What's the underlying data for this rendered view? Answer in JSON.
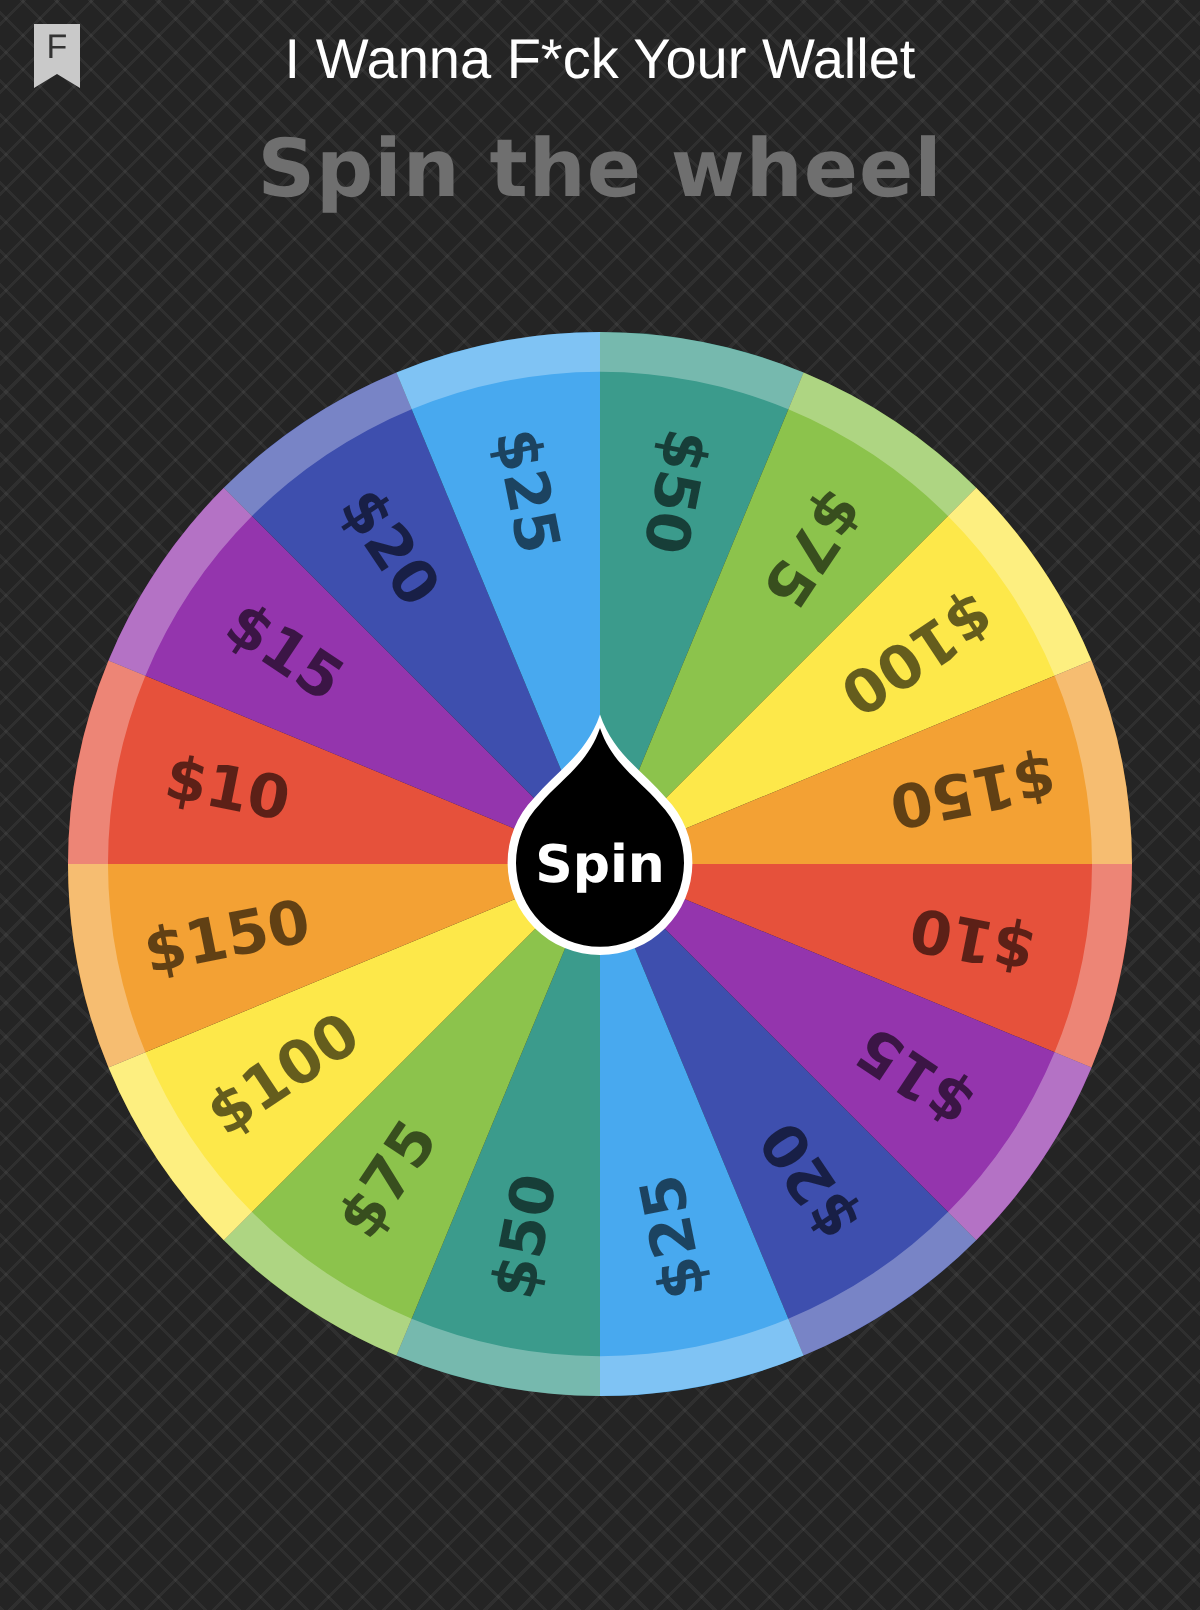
{
  "header": {
    "badge": "F",
    "title": "I Wanna F*ck Your Wallet"
  },
  "heading": "Spin the wheel",
  "wheel": {
    "button": "Spin",
    "segments": [
      {
        "label": "$50",
        "color": "#3b9b8c"
      },
      {
        "label": "$75",
        "color": "#8cc34c"
      },
      {
        "label": "$100",
        "color": "#fde84a"
      },
      {
        "label": "$150",
        "color": "#f3a134"
      },
      {
        "label": "$10",
        "color": "#e6513b"
      },
      {
        "label": "$15",
        "color": "#9435ad"
      },
      {
        "label": "$20",
        "color": "#3e4fae"
      },
      {
        "label": "$25",
        "color": "#48a9ef"
      },
      {
        "label": "$50",
        "color": "#3b9b8c"
      },
      {
        "label": "$75",
        "color": "#8cc34c"
      },
      {
        "label": "$100",
        "color": "#fde84a"
      },
      {
        "label": "$150",
        "color": "#f3a134"
      },
      {
        "label": "$10",
        "color": "#e6513b"
      },
      {
        "label": "$15",
        "color": "#9435ad"
      },
      {
        "label": "$20",
        "color": "#3e4fae"
      },
      {
        "label": "$25",
        "color": "#48a9ef"
      }
    ]
  }
}
